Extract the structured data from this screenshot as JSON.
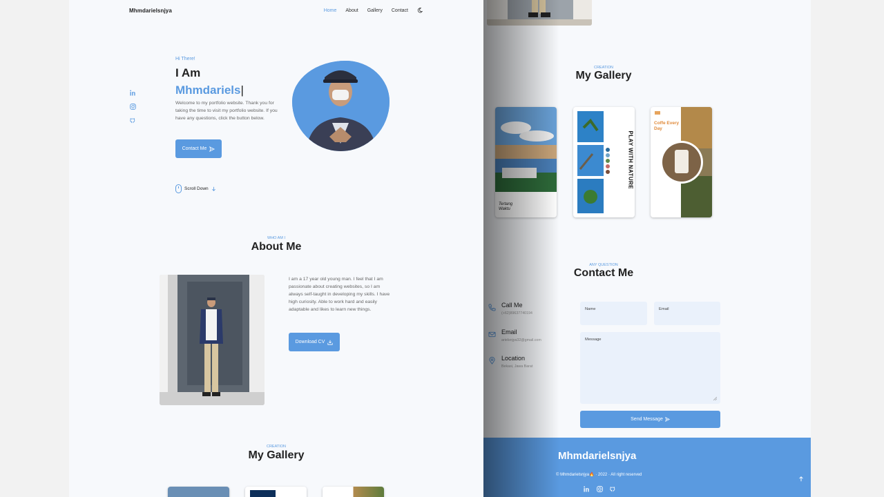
{
  "brand": "Mhmdarielsnjya",
  "nav": {
    "items": [
      "Home",
      "About",
      "Gallery",
      "Contact"
    ],
    "active": "Home"
  },
  "hero": {
    "greeting": "Hi There!",
    "line1": "I Am",
    "name": "Mhmdariels",
    "cursor": "|",
    "intro": "Welcome to my portfolio website. Thank you for taking the time to visit my portfolio website. If you have any questions, click the button below.",
    "cta": "Contact Me",
    "scroll": "Scroll Down"
  },
  "about": {
    "subtitle": "WHO AM I",
    "title": "About Me",
    "text": "I am a 17 year old young man. I feel that I am passionate about creating websites, so I am always self-taught in developing my skills. I have high curiosity. Able to work hard and easily adaptable and likes to learn new things.",
    "cv_button": "Download CV"
  },
  "gallery": {
    "subtitle": "CREATION",
    "title": "My Gallery",
    "cards": [
      {
        "caption": "Tertang Waktu"
      },
      {
        "caption": "PLAY WITH NATURE"
      },
      {
        "caption": "Coffe Every Day"
      }
    ]
  },
  "contact": {
    "subtitle": "ANY QUESTION",
    "title": "Contact Me",
    "items": [
      {
        "label": "Call Me",
        "value": "(+62)89637740194"
      },
      {
        "label": "Email",
        "value": "arielsnjya32@gmail.com"
      },
      {
        "label": "Location",
        "value": "Bekasi, Jawa Barat"
      }
    ],
    "name_placeholder": "Name",
    "email_placeholder": "Email",
    "message_placeholder": "Message",
    "send": "Send Message"
  },
  "footer": {
    "brand": "Mhmdarielsnjya",
    "copyright": "© Mhmdarielsnjya🔥 · 2022 · All right reserved"
  },
  "colors": {
    "accent": "#5a9ae0",
    "text": "#222222",
    "muted": "#666666",
    "bg": "#f7f9fc",
    "field": "#eaf1fb"
  }
}
